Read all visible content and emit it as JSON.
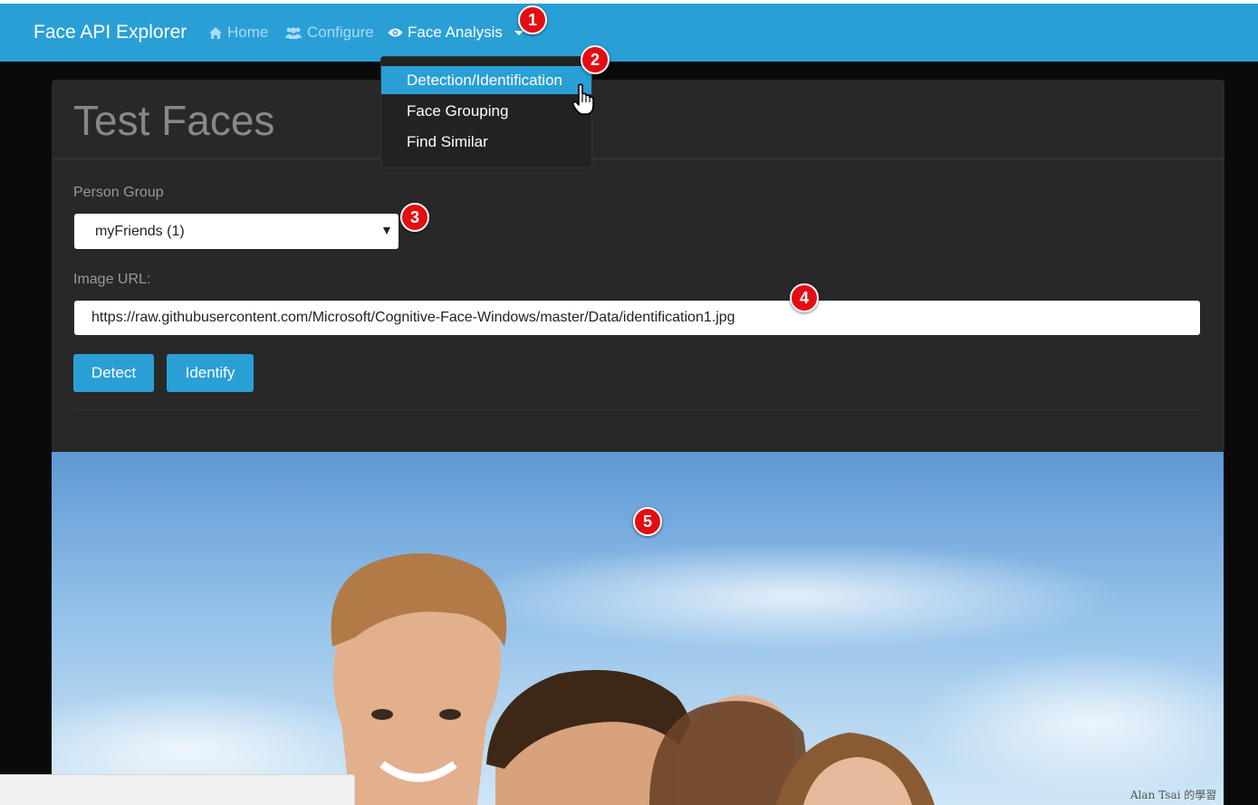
{
  "navbar": {
    "brand": "Face API Explorer",
    "home": "Home",
    "configure": "Configure",
    "face_analysis": "Face Analysis",
    "bg_color": "#2a9fd6"
  },
  "dropdown": {
    "items": [
      "Detection/Identification",
      "Face Grouping",
      "Find Similar"
    ],
    "selected_index": 0
  },
  "panel": {
    "title": "Test Faces",
    "person_group_label": "Person Group",
    "person_group_value": "myFriends (1)",
    "image_url_label": "Image URL:",
    "image_url_value": "https://raw.githubusercontent.com/Microsoft/Cognitive-Face-Windows/master/Data/identification1.jpg",
    "detect_label": "Detect",
    "identify_label": "Identify"
  },
  "markers": [
    "1",
    "2",
    "3",
    "4",
    "5"
  ],
  "watermark": "Alan Tsai 的學習"
}
